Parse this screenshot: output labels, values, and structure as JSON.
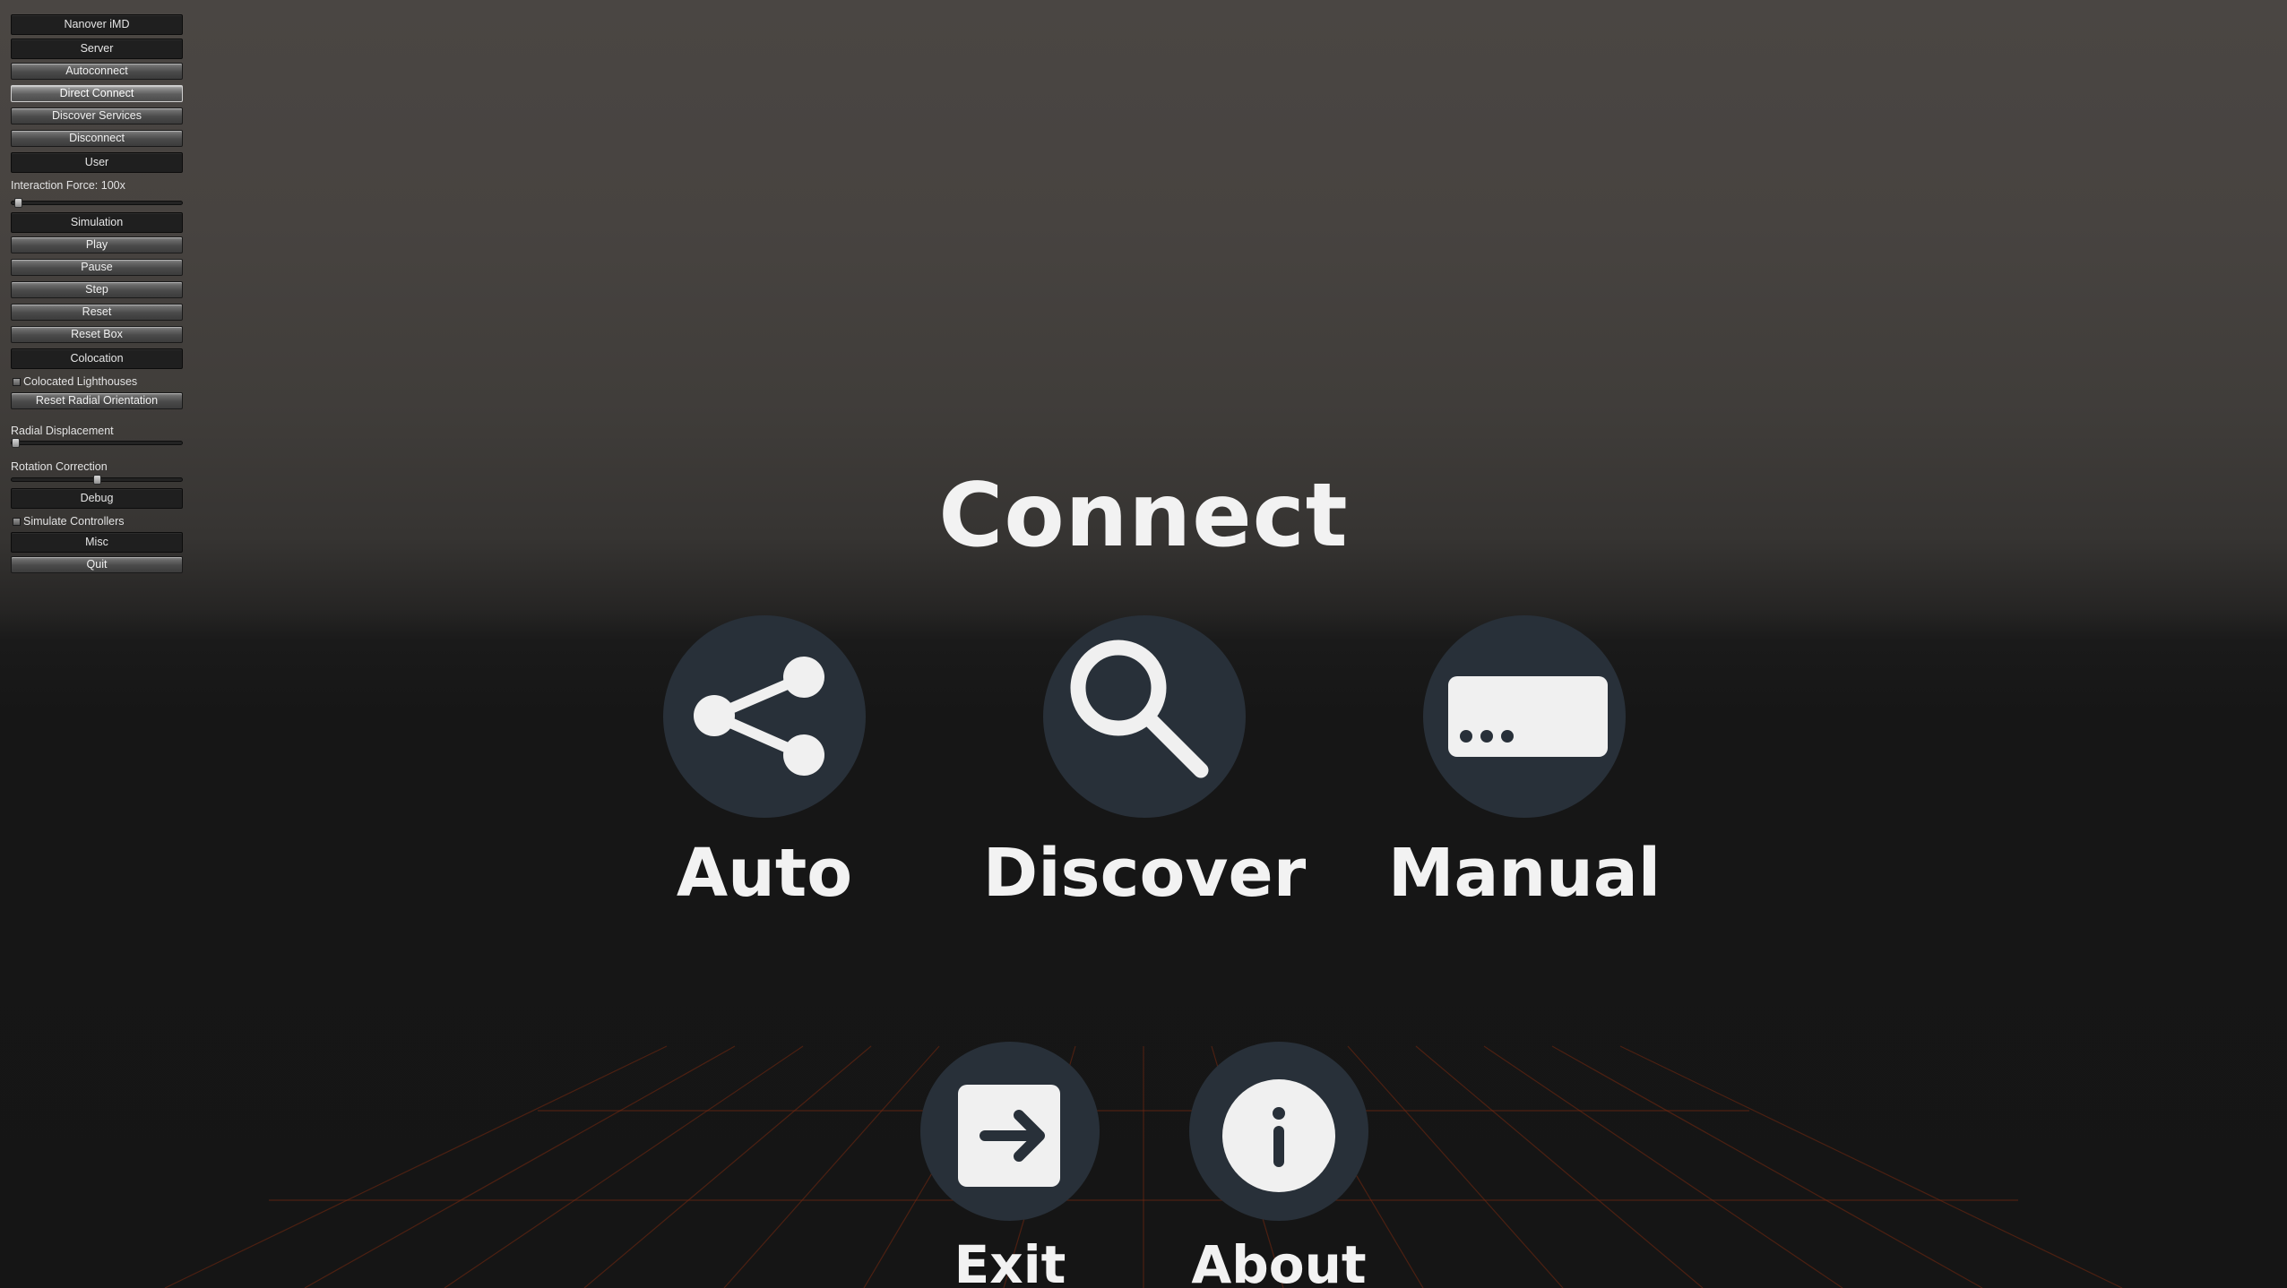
{
  "debug_panel": {
    "title": "Nanover iMD",
    "server": {
      "header": "Server",
      "buttons": [
        "Autoconnect",
        "Direct Connect",
        "Discover Services",
        "Disconnect"
      ]
    },
    "user": {
      "header": "User",
      "interaction_force_label": "Interaction Force: 100x",
      "interaction_force_level": 0.02
    },
    "simulation": {
      "header": "Simulation",
      "buttons": [
        "Play",
        "Pause",
        "Step",
        "Reset",
        "Reset Box"
      ]
    },
    "colocation": {
      "header": "Colocation",
      "colocated_lighthouses_label": "Colocated Lighthouses",
      "colocated_lighthouses_checked": false,
      "reset_radial_label": "Reset Radial Orientation",
      "radial_displacement_label": "Radial Displacement",
      "radial_displacement_level": 0.0,
      "rotation_correction_label": "Rotation Correction",
      "rotation_correction_level": 0.5
    },
    "debug": {
      "header": "Debug",
      "simulate_controllers_label": "Simulate Controllers",
      "simulate_controllers_checked": false
    },
    "misc": {
      "header": "Misc",
      "quit_label": "Quit"
    }
  },
  "menu": {
    "title": "Connect",
    "options": [
      {
        "label": "Auto",
        "icon": "share-icon"
      },
      {
        "label": "Discover",
        "icon": "search-icon"
      },
      {
        "label": "Manual",
        "icon": "keyboard-input-icon"
      }
    ],
    "secondary": [
      {
        "label": "Exit",
        "icon": "exit-icon"
      },
      {
        "label": "About",
        "icon": "info-icon"
      }
    ]
  },
  "colors": {
    "circle_bg": "#283039",
    "icon_fg": "#f0f0f0",
    "grid_line": "#7a2a10",
    "text": "#f2f2f2"
  }
}
